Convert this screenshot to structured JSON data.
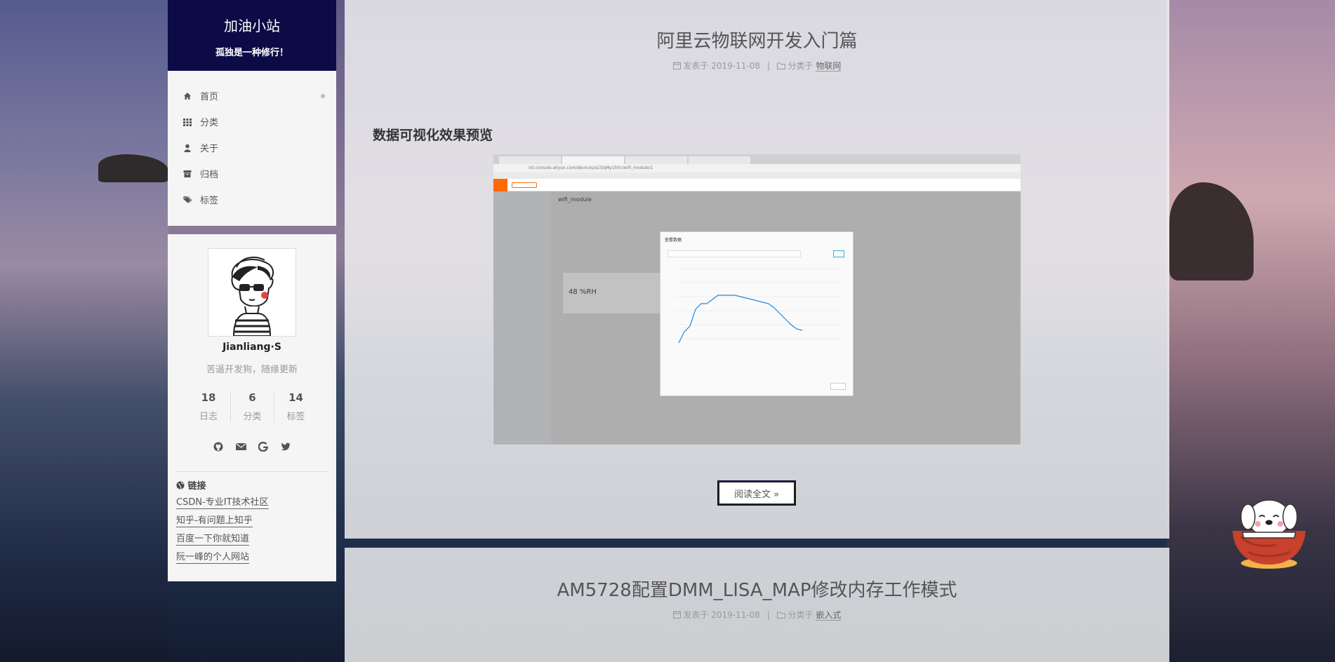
{
  "site": {
    "title": "加油小站",
    "subtitle": "孤独是一种修行！"
  },
  "menu": [
    {
      "label": "首页",
      "icon": "home-icon"
    },
    {
      "label": "分类",
      "icon": "th-icon"
    },
    {
      "label": "关于",
      "icon": "user-icon"
    },
    {
      "label": "归档",
      "icon": "archive-icon"
    },
    {
      "label": "标签",
      "icon": "tags-icon"
    }
  ],
  "profile": {
    "name": "Jianliang·S",
    "description": "苦逼开发狗，随缘更新",
    "stats": [
      {
        "count": "18",
        "label": "日志"
      },
      {
        "count": "6",
        "label": "分类"
      },
      {
        "count": "14",
        "label": "标签"
      }
    ],
    "social": [
      "github-icon",
      "envelope-icon",
      "google-icon",
      "twitter-icon"
    ],
    "links_title": "链接",
    "links": [
      "CSDN-专业IT技术社区",
      "知乎-有问题上知乎",
      "百度一下你就知道",
      "阮一峰的个人网站"
    ]
  },
  "posts": [
    {
      "title": "阿里云物联网开发入门篇",
      "posted_label": "发表于",
      "date": "2019-11-08",
      "category_label": "分类于",
      "category": "物联网",
      "section_heading": "数据可视化效果预览",
      "read_more": "阅读全文 »"
    },
    {
      "title": "AM5728配置DMM_LISA_MAP修改内存工作模式",
      "posted_label": "发表于",
      "date": "2019-11-08",
      "category_label": "分类于",
      "category": "嵌入式"
    }
  ],
  "screenshot": {
    "url": "iot.console.aliyun.com/devices/a1OqMy1hhc/wifi_module/1",
    "device": "wifi_module",
    "reading": "48 %RH",
    "dialog_title": "查看数据"
  },
  "colors": {
    "brand_bg": "#0d0b46",
    "accent": "#ff6a00"
  }
}
